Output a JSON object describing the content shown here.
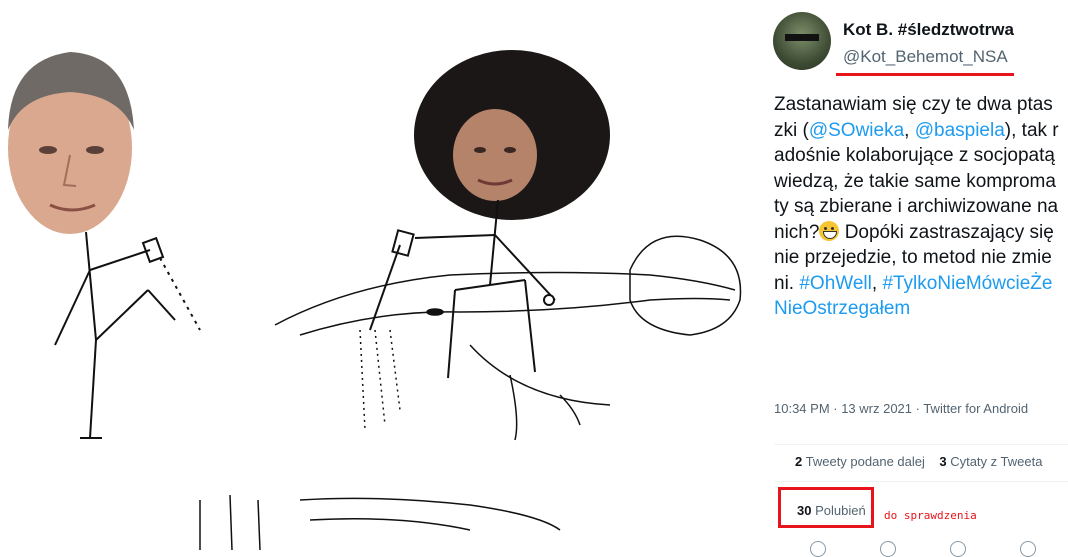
{
  "tweet": {
    "author_name": "Kot B. #śledztwotrwa",
    "author_handle": "@Kot_Behemot_NSA",
    "text_segments": [
      {
        "t": "text",
        "v": "Zastanawiam się czy te dwa ptaszki ("
      },
      {
        "t": "mention",
        "v": "@SOwieka"
      },
      {
        "t": "text",
        "v": ", "
      },
      {
        "t": "mention",
        "v": "@baspiela"
      },
      {
        "t": "text",
        "v": "), tak radośnie kolaborujące z socjopatą wiedzą, że takie same kompromaty są zbierane i archiwizowane na nich?"
      },
      {
        "t": "emoji",
        "v": "grinning-face"
      },
      {
        "t": "text",
        "v": " Dopóki zastraszający się nie przejedzie, to metod nie zmieni. "
      },
      {
        "t": "hashtag",
        "v": "#OhWell"
      },
      {
        "t": "text",
        "v": ", "
      },
      {
        "t": "hashtag",
        "v": "#TylkoNieMówcieŻeNieOstrzegałem"
      }
    ],
    "timestamp": "10:34 PM · 13 wrz 2021 · Twitter for Android",
    "retweets_count": "2",
    "retweets_label": "Tweety podane dalej",
    "quotes_count": "3",
    "quotes_label": "Cytaty z Tweeta",
    "likes_count": "30",
    "likes_label": "Polubień"
  },
  "annotation": {
    "note": "do sprawdzenia",
    "color": "#e8141b"
  },
  "colors": {
    "link": "#1d9bf0",
    "text": "#0f1419",
    "muted": "#536471"
  }
}
